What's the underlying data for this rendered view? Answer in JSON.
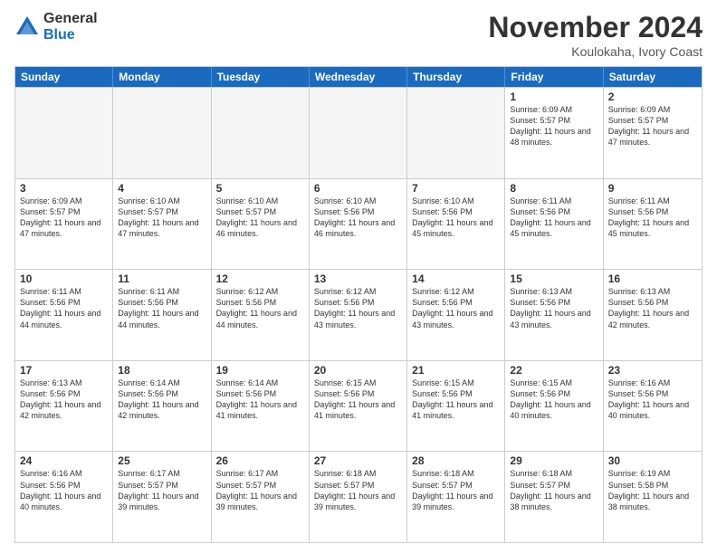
{
  "logo": {
    "general": "General",
    "blue": "Blue"
  },
  "header": {
    "month": "November 2024",
    "location": "Koulokaha, Ivory Coast"
  },
  "weekdays": [
    "Sunday",
    "Monday",
    "Tuesday",
    "Wednesday",
    "Thursday",
    "Friday",
    "Saturday"
  ],
  "rows": [
    [
      {
        "day": "",
        "empty": true
      },
      {
        "day": "",
        "empty": true
      },
      {
        "day": "",
        "empty": true
      },
      {
        "day": "",
        "empty": true
      },
      {
        "day": "",
        "empty": true
      },
      {
        "day": "1",
        "rise": "6:09 AM",
        "set": "5:57 PM",
        "daylight": "11 hours and 48 minutes."
      },
      {
        "day": "2",
        "rise": "6:09 AM",
        "set": "5:57 PM",
        "daylight": "11 hours and 47 minutes."
      }
    ],
    [
      {
        "day": "3",
        "rise": "6:09 AM",
        "set": "5:57 PM",
        "daylight": "11 hours and 47 minutes."
      },
      {
        "day": "4",
        "rise": "6:10 AM",
        "set": "5:57 PM",
        "daylight": "11 hours and 47 minutes."
      },
      {
        "day": "5",
        "rise": "6:10 AM",
        "set": "5:57 PM",
        "daylight": "11 hours and 46 minutes."
      },
      {
        "day": "6",
        "rise": "6:10 AM",
        "set": "5:56 PM",
        "daylight": "11 hours and 46 minutes."
      },
      {
        "day": "7",
        "rise": "6:10 AM",
        "set": "5:56 PM",
        "daylight": "11 hours and 45 minutes."
      },
      {
        "day": "8",
        "rise": "6:11 AM",
        "set": "5:56 PM",
        "daylight": "11 hours and 45 minutes."
      },
      {
        "day": "9",
        "rise": "6:11 AM",
        "set": "5:56 PM",
        "daylight": "11 hours and 45 minutes."
      }
    ],
    [
      {
        "day": "10",
        "rise": "6:11 AM",
        "set": "5:56 PM",
        "daylight": "11 hours and 44 minutes."
      },
      {
        "day": "11",
        "rise": "6:11 AM",
        "set": "5:56 PM",
        "daylight": "11 hours and 44 minutes."
      },
      {
        "day": "12",
        "rise": "6:12 AM",
        "set": "5:56 PM",
        "daylight": "11 hours and 44 minutes."
      },
      {
        "day": "13",
        "rise": "6:12 AM",
        "set": "5:56 PM",
        "daylight": "11 hours and 43 minutes."
      },
      {
        "day": "14",
        "rise": "6:12 AM",
        "set": "5:56 PM",
        "daylight": "11 hours and 43 minutes."
      },
      {
        "day": "15",
        "rise": "6:13 AM",
        "set": "5:56 PM",
        "daylight": "11 hours and 43 minutes."
      },
      {
        "day": "16",
        "rise": "6:13 AM",
        "set": "5:56 PM",
        "daylight": "11 hours and 42 minutes."
      }
    ],
    [
      {
        "day": "17",
        "rise": "6:13 AM",
        "set": "5:56 PM",
        "daylight": "11 hours and 42 minutes."
      },
      {
        "day": "18",
        "rise": "6:14 AM",
        "set": "5:56 PM",
        "daylight": "11 hours and 42 minutes."
      },
      {
        "day": "19",
        "rise": "6:14 AM",
        "set": "5:56 PM",
        "daylight": "11 hours and 41 minutes."
      },
      {
        "day": "20",
        "rise": "6:15 AM",
        "set": "5:56 PM",
        "daylight": "11 hours and 41 minutes."
      },
      {
        "day": "21",
        "rise": "6:15 AM",
        "set": "5:56 PM",
        "daylight": "11 hours and 41 minutes."
      },
      {
        "day": "22",
        "rise": "6:15 AM",
        "set": "5:56 PM",
        "daylight": "11 hours and 40 minutes."
      },
      {
        "day": "23",
        "rise": "6:16 AM",
        "set": "5:56 PM",
        "daylight": "11 hours and 40 minutes."
      }
    ],
    [
      {
        "day": "24",
        "rise": "6:16 AM",
        "set": "5:56 PM",
        "daylight": "11 hours and 40 minutes."
      },
      {
        "day": "25",
        "rise": "6:17 AM",
        "set": "5:57 PM",
        "daylight": "11 hours and 39 minutes."
      },
      {
        "day": "26",
        "rise": "6:17 AM",
        "set": "5:57 PM",
        "daylight": "11 hours and 39 minutes."
      },
      {
        "day": "27",
        "rise": "6:18 AM",
        "set": "5:57 PM",
        "daylight": "11 hours and 39 minutes."
      },
      {
        "day": "28",
        "rise": "6:18 AM",
        "set": "5:57 PM",
        "daylight": "11 hours and 39 minutes."
      },
      {
        "day": "29",
        "rise": "6:18 AM",
        "set": "5:57 PM",
        "daylight": "11 hours and 38 minutes."
      },
      {
        "day": "30",
        "rise": "6:19 AM",
        "set": "5:58 PM",
        "daylight": "11 hours and 38 minutes."
      }
    ]
  ]
}
